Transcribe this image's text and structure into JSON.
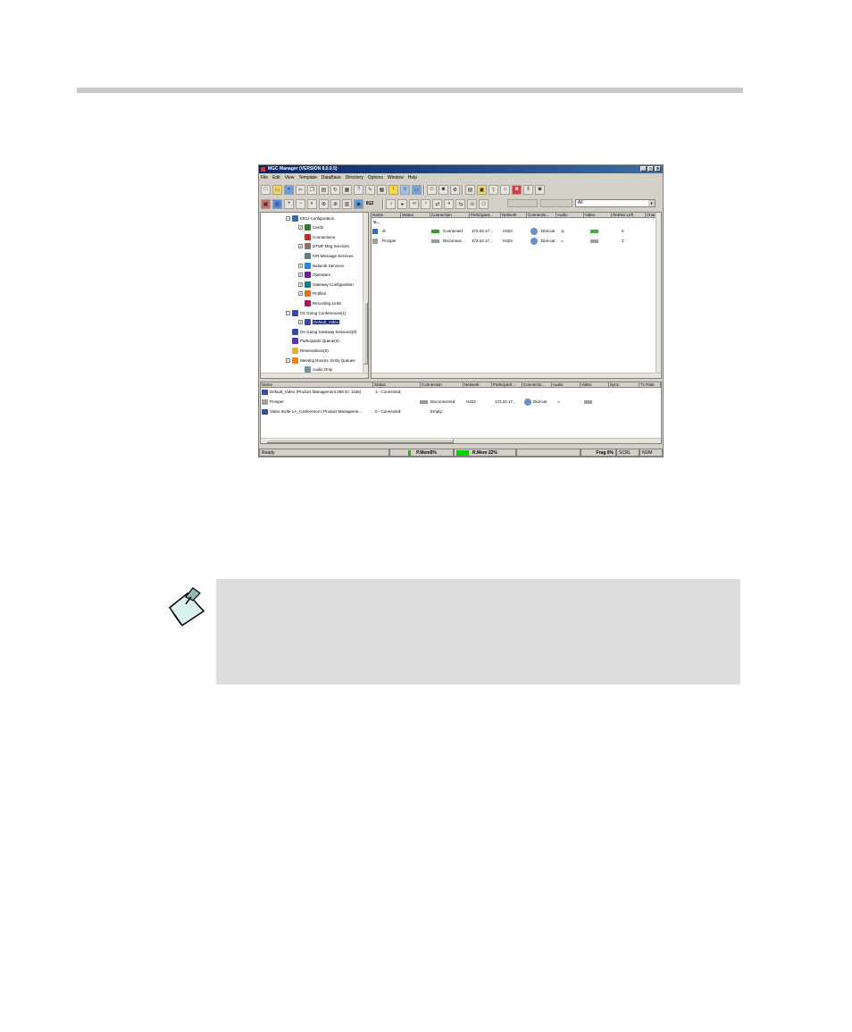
{
  "window": {
    "title": "MGC Manager (VERSION 8.0.0.5)",
    "controls": [
      "_",
      "□",
      "x"
    ]
  },
  "menu": [
    "File",
    "Edit",
    "View",
    "Template",
    "DataBase",
    "Directory",
    "Options",
    "Window",
    "Help"
  ],
  "toolbar2": {
    "label_812": "812"
  },
  "filter": {
    "value": "All"
  },
  "tree": {
    "items": [
      {
        "label": "MCU Configuration",
        "expander": "−",
        "color": "#3a6ea5"
      },
      {
        "label": "Cards",
        "expander": "+",
        "color": "#2e7d32"
      },
      {
        "label": "Connections",
        "expander": "",
        "color": "#c62828"
      },
      {
        "label": "DTMF Msg Services",
        "expander": "+",
        "color": "#8d6e63"
      },
      {
        "label": "IVR Message Services",
        "expander": "",
        "color": "#607d8b"
      },
      {
        "label": "Network Services",
        "expander": "+",
        "color": "#1e88e5"
      },
      {
        "label": "Operators",
        "expander": "+",
        "color": "#6a1b9a"
      },
      {
        "label": "Gateway Configuration",
        "expander": "+",
        "color": "#00838f"
      },
      {
        "label": "Profiles",
        "expander": "+",
        "color": "#ef6c00"
      },
      {
        "label": "Recording Links",
        "expander": "",
        "color": "#ad1457"
      },
      {
        "label": "On Going Conferences(1)",
        "expander": "−",
        "color": "#3949ab"
      },
      {
        "label": "Default_Video",
        "expander": "+",
        "color": "#3949ab"
      },
      {
        "label": "On Going Gateway Sessions(0)",
        "expander": "",
        "color": "#3949ab"
      },
      {
        "label": "Participants Queue(0)",
        "expander": "",
        "color": "#5e35b1"
      },
      {
        "label": "Reservations(0)",
        "expander": "",
        "color": "#f9a825"
      },
      {
        "label": "Meeting Rooms, Entry Queues",
        "expander": "−",
        "color": "#f57f17"
      },
      {
        "label": "Audio Only",
        "expander": "",
        "color": "#78909c"
      }
    ]
  },
  "grid": {
    "columns": [
      "Name",
      "Status",
      "Connection",
      "Participant...",
      "Network",
      "Connectio...",
      "Audio",
      "Video",
      "Retries Left",
      "Char"
    ],
    "group_row": "S...",
    "rows": [
      {
        "name": "dr",
        "connection": "Connected",
        "participant": "172.22.17...",
        "network": "H323",
        "connection_type": "Dial-out",
        "retries": "0"
      },
      {
        "name": "Prosper",
        "connection": "Disconnec...",
        "participant": "172.22.17...",
        "network": "H323",
        "connection_type": "Dial-out",
        "retries": "2"
      }
    ]
  },
  "bottom": {
    "columns": [
      "Name",
      "Status",
      "Connection",
      "Network",
      "Participant...",
      "Connectio...",
      "Audio",
      "Video",
      "Sync.",
      "Tx Rate"
    ],
    "rows": [
      {
        "name": "Default_Video (Product Management 258 ID: 1156)",
        "status": "1 - Connected;",
        "connection": "",
        "network": "",
        "participant": "",
        "connection_type": ""
      },
      {
        "name": "Prosper",
        "status": "",
        "connection": "Disconnected",
        "network": "H323",
        "participant": "172.22.17...",
        "connection_type": "Dial-out"
      },
      {
        "name": "Video Invite 1A_Conference ( Product Manageme...",
        "status": "0 - Connected;",
        "connection": "Empty;",
        "network": "",
        "participant": "",
        "connection_type": ""
      }
    ]
  },
  "statusbar": {
    "ready": "Ready",
    "pmem": "P.Mem5%",
    "rmem": "R.Mem 22%",
    "frag": "Frag 0%",
    "scrl": "SCRL",
    "num": "NUM"
  }
}
